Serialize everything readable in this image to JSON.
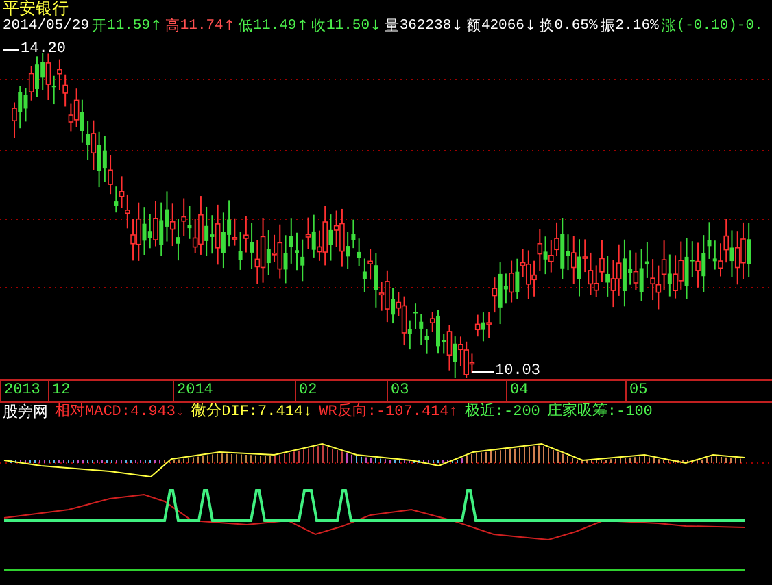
{
  "stock": {
    "name": "平安银行",
    "date": "2014/05/29"
  },
  "quote": [
    {
      "label": "开",
      "value": "11.59",
      "arrow": "↑",
      "color": "#4cf04c"
    },
    {
      "label": "高",
      "value": "11.74",
      "arrow": "↑",
      "color": "#ff5050"
    },
    {
      "label": "低",
      "value": "11.49",
      "arrow": "↑",
      "color": "#4cf04c"
    },
    {
      "label": "收",
      "value": "11.50",
      "arrow": "↓",
      "color": "#4cf04c"
    },
    {
      "label": "量",
      "value": "362238",
      "arrow": "↓",
      "color": "#ffffff"
    },
    {
      "label": "额",
      "value": "42066",
      "arrow": "↓",
      "color": "#ffffff"
    },
    {
      "label": "换",
      "value": "0.65%",
      "color": "#ffffff"
    },
    {
      "label": "振",
      "value": "2.16%",
      "color": "#ffffff"
    },
    {
      "label": "涨",
      "value": "(-0.10)-0.",
      "color": "#4cf04c"
    }
  ],
  "price_chart": {
    "high_label": "14.20",
    "low_label": "10.03"
  },
  "time_axis": [
    "2013",
    "12",
    "2014",
    "02",
    "03",
    "04",
    "05"
  ],
  "indicator": {
    "name": "股旁网",
    "values": [
      {
        "label": "相对MACD:4.943",
        "arrow": "↓",
        "color": "#ff3030"
      },
      {
        "label": "微分DIF:7.414",
        "arrow": "↓",
        "color": "#ffff40"
      },
      {
        "label": "WR反向:-107.414",
        "arrow": "↑",
        "color": "#ff3030"
      },
      {
        "label": "极近:-200",
        "color": "#4cf04c"
      },
      {
        "label": "庄家吸筹:-100",
        "color": "#4cf04c"
      }
    ]
  }
}
